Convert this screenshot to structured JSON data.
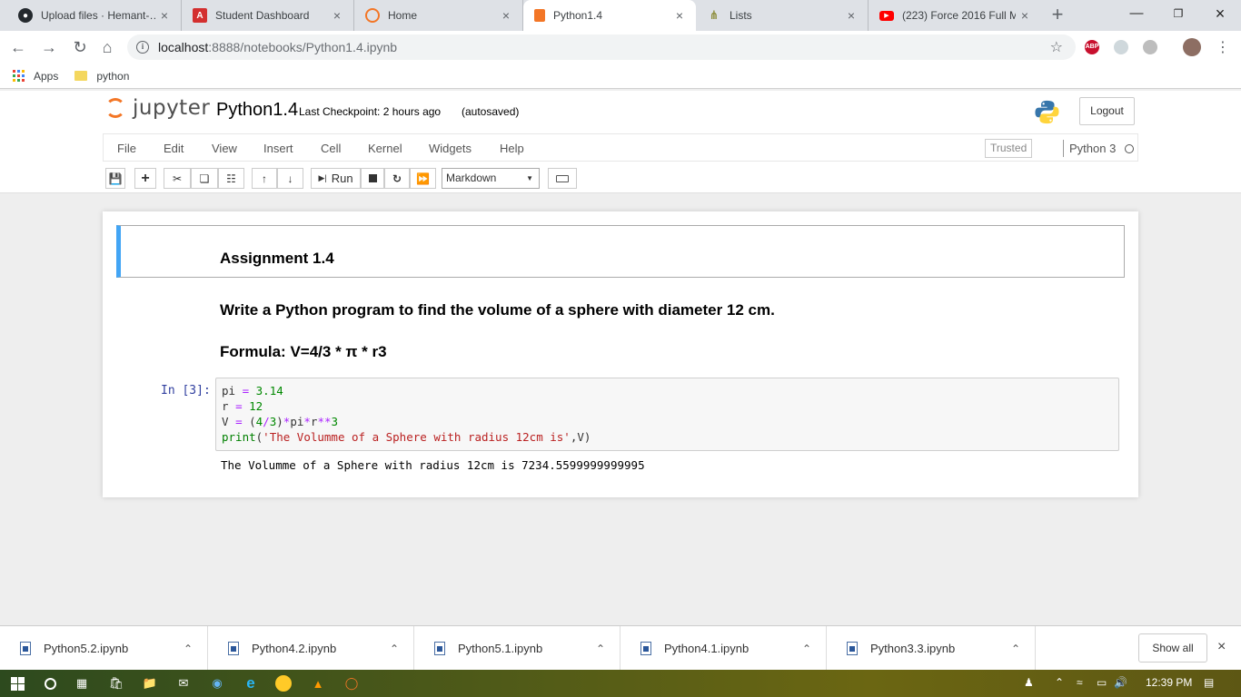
{
  "browser": {
    "tabs": [
      {
        "title": "Upload files · Hemant-…",
        "icon": "github-icon",
        "color": "#24292e"
      },
      {
        "title": "Student Dashboard",
        "icon": "a-logo-icon",
        "color": "#d32f2f"
      },
      {
        "title": "Home",
        "icon": "jupyter-icon",
        "color": "#f37626"
      },
      {
        "title": "Python1.4",
        "icon": "jupyter-notebook-icon",
        "color": "#f37626",
        "active": true
      },
      {
        "title": "Lists",
        "icon": "fork-icon",
        "color": "#8d8d3b"
      },
      {
        "title": "(223) Force 2016 Full M",
        "icon": "youtube-icon",
        "color": "#ff0000"
      }
    ],
    "url_host": "localhost",
    "url_path": ":8888/notebooks/Python1.4.ipynb",
    "extensions": {
      "abp_label": "ABP"
    },
    "bookmarks": [
      {
        "label": "Apps",
        "icon": "apps-grid-icon"
      },
      {
        "label": "python",
        "icon": "folder-icon"
      }
    ]
  },
  "jupyter": {
    "logo_text": "jupyter",
    "notebook_name": "Python1.4",
    "checkpoint": "Last Checkpoint: 2 hours ago",
    "autosave": "(autosaved)",
    "logout_label": "Logout",
    "menus": [
      "File",
      "Edit",
      "View",
      "Insert",
      "Cell",
      "Kernel",
      "Widgets",
      "Help"
    ],
    "trusted_label": "Trusted",
    "kernel_name": "Python 3",
    "toolbar": {
      "run_label": "Run",
      "cell_type": "Markdown"
    }
  },
  "notebook": {
    "assignment_heading": "Assignment 1.4",
    "task": "Write a Python program to find the volume of a sphere with diameter 12 cm.",
    "formula": "Formula: V=4/3 * π * r3",
    "prompt": "In [3]:",
    "code": [
      "pi = 3.14",
      "r = 12",
      "V = (4/3)*pi*r**3",
      "print('The Volumme of a Sphere with radius 12cm is',V)"
    ],
    "output": "The Volumme of a Sphere with radius 12cm is 7234.5599999999995"
  },
  "downloads": {
    "files": [
      "Python5.2.ipynb",
      "Python4.2.ipynb",
      "Python5.1.ipynb",
      "Python4.1.ipynb",
      "Python3.3.ipynb"
    ],
    "show_all": "Show all"
  },
  "taskbar": {
    "time": "12:39 PM"
  }
}
